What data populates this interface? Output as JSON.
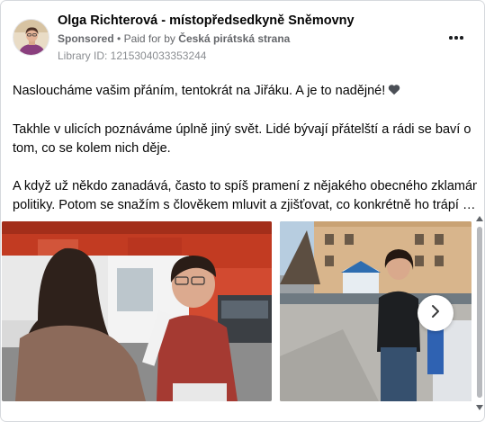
{
  "post": {
    "author": "Olga Richterová - místopředsedkyně Sněmovny",
    "sponsored_label": "Sponsored",
    "separator": "•",
    "paid_for_label": "Paid for by",
    "paid_for_page": "Česká pirátská strana",
    "library_id": "Library ID: 1215304033353244",
    "more_icon": "more-horizontal-icon",
    "text": {
      "line1": "Nasloucháme vašim přáním, tentokrát na Jiřáku. A je to nadějné!",
      "emoji": "black-heart-icon",
      "line2": "Takhle v ulicích poznáváme úplně jiný svět. Lidé bývají přátelští a rádi se baví o",
      "line3": "tom, co se kolem nich děje.",
      "line4": "A když už někdo zanadává, často to spíš pramení z nějakého obecného zklamání z",
      "line5": "politiky. Potom se snažím s člověkem mluvit a zjišťovat, co konkrétně ho trápí a c…"
    }
  },
  "carousel": {
    "slides": [
      {
        "name": "photo-conversation-street"
      },
      {
        "name": "photo-square-tent"
      }
    ],
    "next_icon": "chevron-right-icon"
  },
  "scrollbar": {
    "up_icon": "scroll-up-arrow-icon",
    "down_icon": "scroll-down-arrow-icon"
  },
  "colors": {
    "text_primary": "#050505",
    "text_secondary": "#65676b",
    "border": "#d6d9dd",
    "heart": "#4b4f56"
  }
}
